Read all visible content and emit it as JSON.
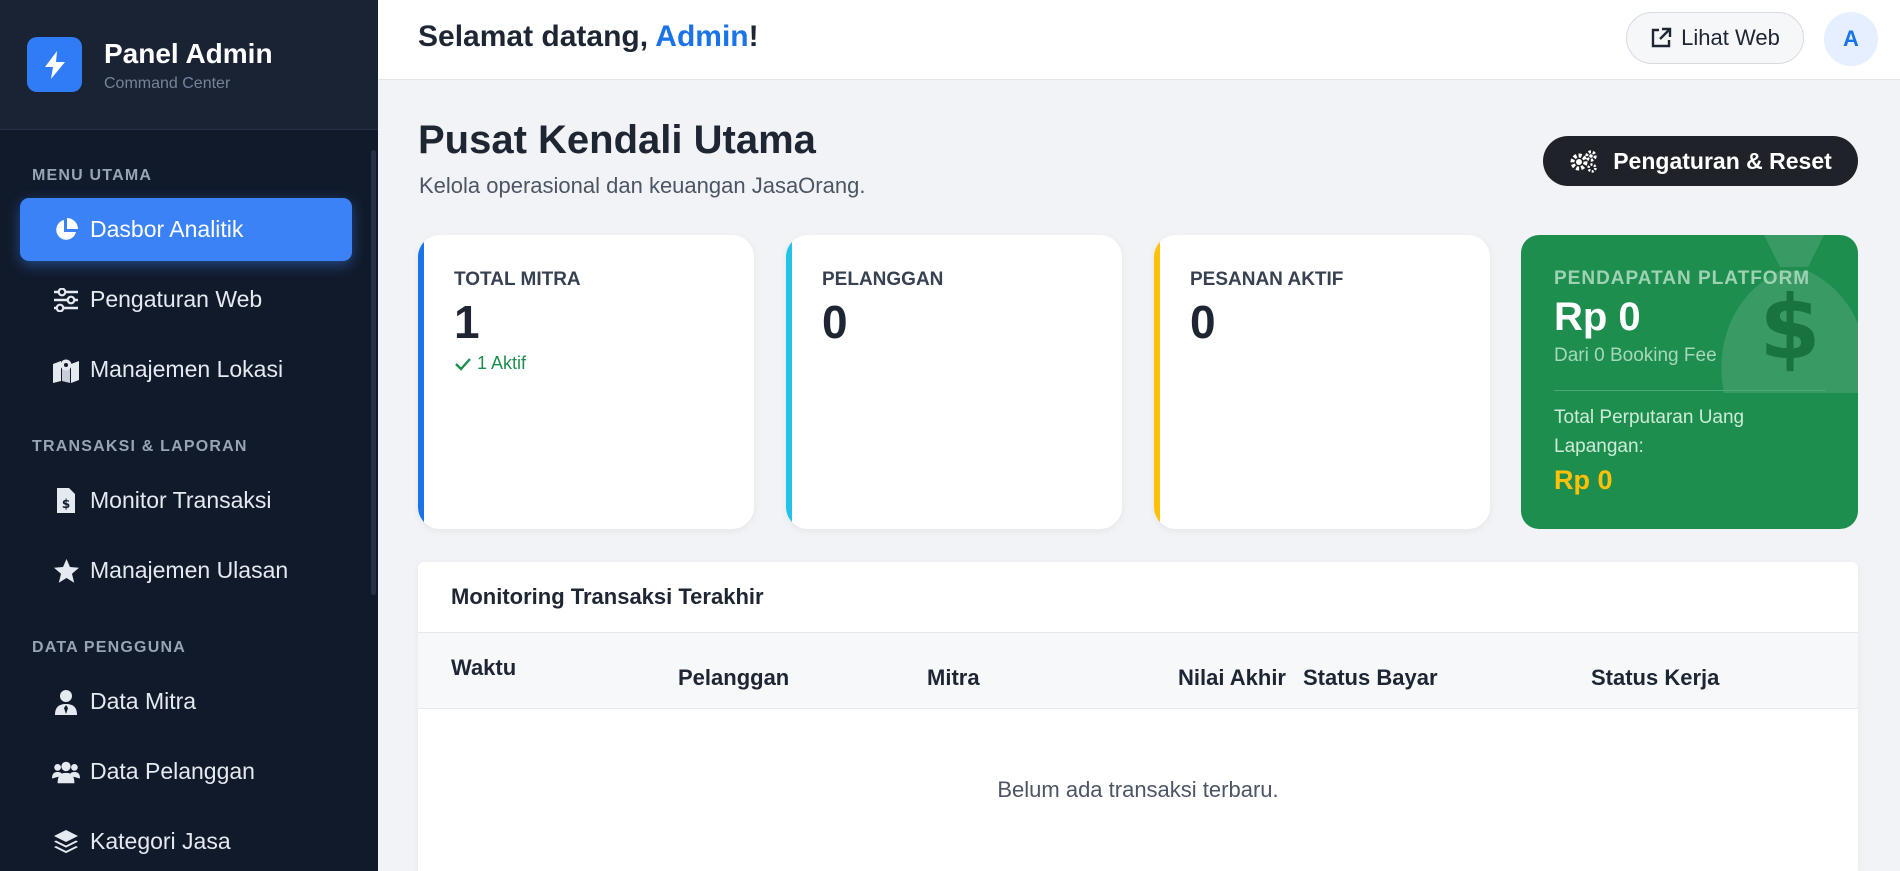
{
  "sidebar": {
    "brand_title": "Panel Admin",
    "brand_subtitle": "Command Center",
    "sections": [
      {
        "label": "MENU UTAMA"
      },
      {
        "label": "TRANSAKSI & LAPORAN"
      },
      {
        "label": "DATA PENGGUNA"
      }
    ],
    "items": [
      {
        "label": "Dasbor Analitik",
        "icon": "pie-chart-icon",
        "active": true
      },
      {
        "label": "Pengaturan Web",
        "icon": "sliders-icon"
      },
      {
        "label": "Manajemen Lokasi",
        "icon": "map-icon"
      },
      {
        "label": "Monitor Transaksi",
        "icon": "invoice-icon"
      },
      {
        "label": "Manajemen Ulasan",
        "icon": "star-icon"
      },
      {
        "label": "Data Mitra",
        "icon": "user-tie-icon"
      },
      {
        "label": "Data Pelanggan",
        "icon": "users-icon"
      },
      {
        "label": "Kategori Jasa",
        "icon": "layers-icon"
      }
    ]
  },
  "header": {
    "welcome_prefix": "Selamat datang, ",
    "welcome_name": "Admin",
    "welcome_suffix": "!",
    "view_web_label": "Lihat Web",
    "avatar_initial": "A"
  },
  "main": {
    "title": "Pusat Kendali Utama",
    "subtitle": "Kelola operasional dan keuangan JasaOrang.",
    "settings_button": "Pengaturan & Reset",
    "stats": [
      {
        "label": "TOTAL MITRA",
        "value": "1",
        "note": "1 Aktif",
        "accent": "#1a73e8"
      },
      {
        "label": "PELANGGAN",
        "value": "0",
        "accent": "#22c3e6"
      },
      {
        "label": "PESANAN AKTIF",
        "value": "0",
        "accent": "#ffc107"
      }
    ],
    "revenue": {
      "label": "PENDAPATAN PLATFORM",
      "value": "Rp 0",
      "sub": "Dari 0 Booking Fee",
      "total_label": "Total Perputaran Uang Lapangan:",
      "total_value": "Rp 0",
      "bg_color": "#1e8e4e"
    },
    "transactions": {
      "title": "Monitoring Transaksi Terakhir",
      "columns": [
        "Waktu",
        "Pelanggan",
        "Mitra",
        "Nilai Akhir",
        "Status Bayar",
        "Status Kerja"
      ],
      "empty_text": "Belum ada transaksi terbaru."
    }
  }
}
